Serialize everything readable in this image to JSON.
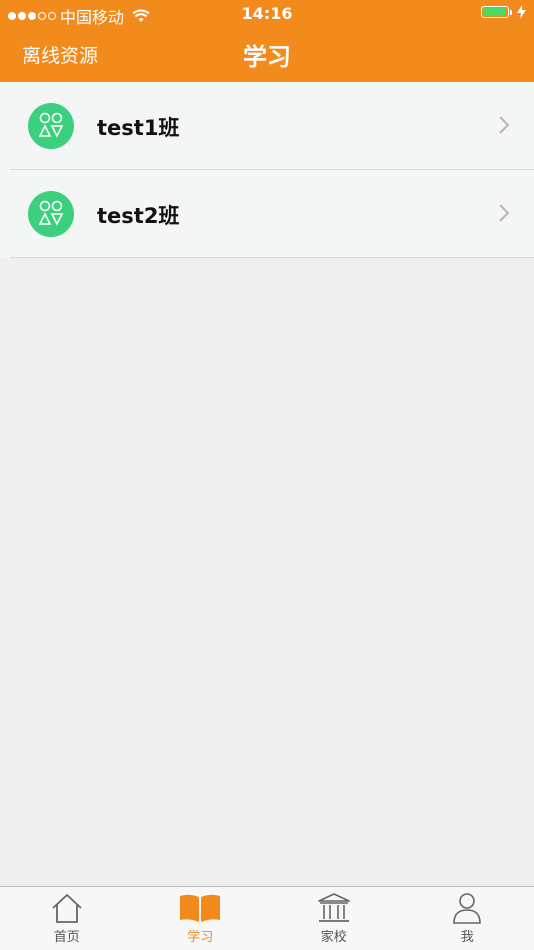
{
  "status_bar": {
    "carrier": "中国移动",
    "time": "14:16",
    "battery_level": 0.9
  },
  "nav": {
    "left_label": "离线资源",
    "title": "学习"
  },
  "classes": [
    {
      "label": "test1班"
    },
    {
      "label": "test2班"
    }
  ],
  "tabs": [
    {
      "label": "首页",
      "icon": "home-icon"
    },
    {
      "label": "学习",
      "icon": "book-icon",
      "active": true
    },
    {
      "label": "家校",
      "icon": "school-building-icon"
    },
    {
      "label": "我",
      "icon": "person-icon"
    }
  ],
  "colors": {
    "accent": "#f38a1c",
    "avatar": "#3ccf7d",
    "battery": "#4cd964"
  }
}
